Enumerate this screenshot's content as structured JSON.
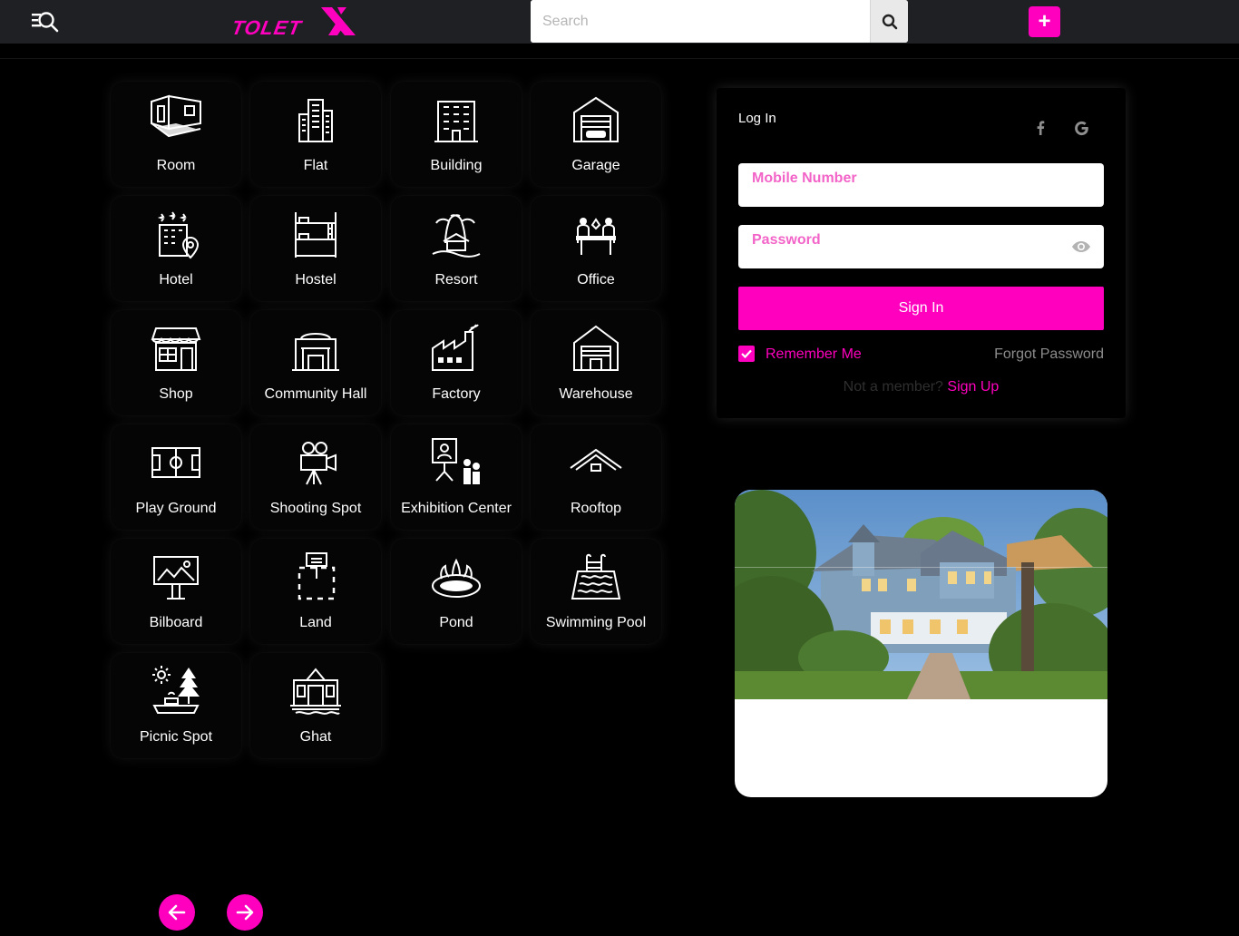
{
  "header": {
    "logo_text": "TOLETX",
    "search_placeholder": "Search",
    "add_label": "+"
  },
  "categories": [
    {
      "label": "Room",
      "icon": "room-icon"
    },
    {
      "label": "Flat",
      "icon": "flat-icon"
    },
    {
      "label": "Building",
      "icon": "building-icon"
    },
    {
      "label": "Garage",
      "icon": "garage-icon"
    },
    {
      "label": "Hotel",
      "icon": "hotel-icon"
    },
    {
      "label": "Hostel",
      "icon": "hostel-icon"
    },
    {
      "label": "Resort",
      "icon": "resort-icon"
    },
    {
      "label": "Office",
      "icon": "office-icon"
    },
    {
      "label": "Shop",
      "icon": "shop-icon"
    },
    {
      "label": "Community Hall",
      "icon": "community-hall-icon"
    },
    {
      "label": "Factory",
      "icon": "factory-icon"
    },
    {
      "label": "Warehouse",
      "icon": "warehouse-icon"
    },
    {
      "label": "Play Ground",
      "icon": "play-ground-icon"
    },
    {
      "label": "Shooting Spot",
      "icon": "shooting-spot-icon"
    },
    {
      "label": "Exhibition Center",
      "icon": "exhibition-center-icon"
    },
    {
      "label": "Rooftop",
      "icon": "rooftop-icon"
    },
    {
      "label": "Bilboard",
      "icon": "billboard-icon"
    },
    {
      "label": "Land",
      "icon": "land-icon"
    },
    {
      "label": "Pond",
      "icon": "pond-icon"
    },
    {
      "label": "Swimming Pool",
      "icon": "swimming-pool-icon"
    },
    {
      "label": "Picnic Spot",
      "icon": "picnic-spot-icon"
    },
    {
      "label": "Ghat",
      "icon": "ghat-icon"
    }
  ],
  "login": {
    "title": "Log In",
    "mobile_placeholder": "Mobile Number",
    "password_placeholder": "Password",
    "signin_label": "Sign In",
    "remember_label": "Remember Me",
    "remember_checked": true,
    "forgot_label": "Forgot Password",
    "not_member_label": "Not a member?",
    "signup_label": "Sign Up"
  },
  "colors": {
    "accent": "#ff00bf",
    "topbar": "#1f2023",
    "background": "#000000"
  }
}
